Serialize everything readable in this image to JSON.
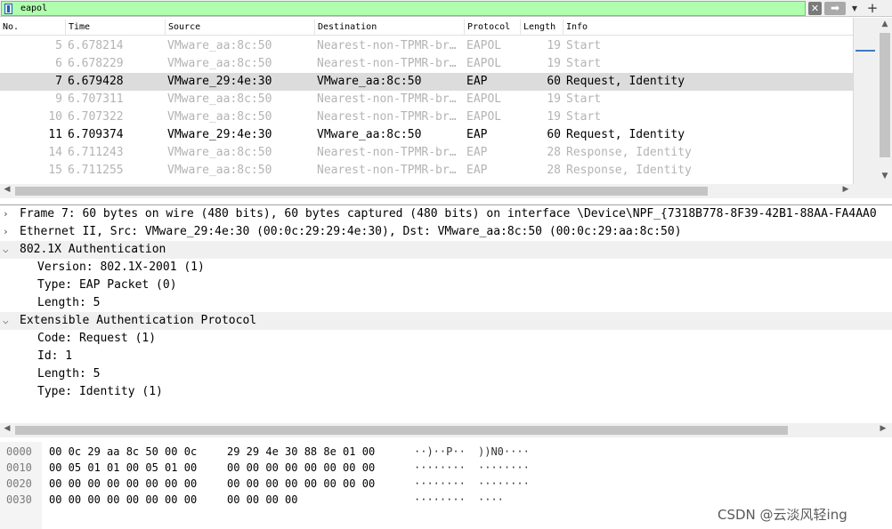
{
  "filter": {
    "value": "eapol"
  },
  "columns": {
    "no": "No.",
    "time": "Time",
    "source": "Source",
    "destination": "Destination",
    "protocol": "Protocol",
    "length": "Length",
    "info": "Info"
  },
  "packets": [
    {
      "no": "5",
      "time": "6.678214",
      "source": "VMware_aa:8c:50",
      "destination": "Nearest-non-TPMR-br…",
      "protocol": "EAPOL",
      "length": "19",
      "info": "Start",
      "style": "dim"
    },
    {
      "no": "6",
      "time": "6.678229",
      "source": "VMware_aa:8c:50",
      "destination": "Nearest-non-TPMR-br…",
      "protocol": "EAPOL",
      "length": "19",
      "info": "Start",
      "style": "dim"
    },
    {
      "no": "7",
      "time": "6.679428",
      "source": "VMware_29:4e:30",
      "destination": "VMware_aa:8c:50",
      "protocol": "EAP",
      "length": "60",
      "info": "Request, Identity",
      "style": "selected"
    },
    {
      "no": "9",
      "time": "6.707311",
      "source": "VMware_aa:8c:50",
      "destination": "Nearest-non-TPMR-br…",
      "protocol": "EAPOL",
      "length": "19",
      "info": "Start",
      "style": "dim"
    },
    {
      "no": "10",
      "time": "6.707322",
      "source": "VMware_aa:8c:50",
      "destination": "Nearest-non-TPMR-br…",
      "protocol": "EAPOL",
      "length": "19",
      "info": "Start",
      "style": "dim"
    },
    {
      "no": "11",
      "time": "6.709374",
      "source": "VMware_29:4e:30",
      "destination": "VMware_aa:8c:50",
      "protocol": "EAP",
      "length": "60",
      "info": "Request, Identity",
      "style": "eap"
    },
    {
      "no": "14",
      "time": "6.711243",
      "source": "VMware_aa:8c:50",
      "destination": "Nearest-non-TPMR-br…",
      "protocol": "EAP",
      "length": "28",
      "info": "Response, Identity",
      "style": "dim"
    },
    {
      "no": "15",
      "time": "6.711255",
      "source": "VMware_aa:8c:50",
      "destination": "Nearest-non-TPMR-br…",
      "protocol": "EAP",
      "length": "28",
      "info": "Response, Identity",
      "style": "dim"
    }
  ],
  "details": [
    {
      "text": "Frame 7: 60 bytes on wire (480 bits), 60 bytes captured (480 bits) on interface \\Device\\NPF_{7318B778-8F39-42B1-88AA-FA4AA0",
      "level": 0,
      "toggle": ">"
    },
    {
      "text": "Ethernet II, Src: VMware_29:4e:30 (00:0c:29:29:4e:30), Dst: VMware_aa:8c:50 (00:0c:29:aa:8c:50)",
      "level": 0,
      "toggle": ">"
    },
    {
      "text": "802.1X Authentication",
      "level": 0,
      "toggle": "v",
      "section": true
    },
    {
      "text": "Version: 802.1X-2001 (1)",
      "level": 1
    },
    {
      "text": "Type: EAP Packet (0)",
      "level": 1
    },
    {
      "text": "Length: 5",
      "level": 1
    },
    {
      "text": "Extensible Authentication Protocol",
      "level": 0,
      "toggle": "v",
      "section": true
    },
    {
      "text": "Code: Request (1)",
      "level": 1
    },
    {
      "text": "Id: 1",
      "level": 1
    },
    {
      "text": "Length: 5",
      "level": 1
    },
    {
      "text": "Type: Identity (1)",
      "level": 1
    }
  ],
  "hex": [
    {
      "offset": "0000",
      "bytes1": "00 0c 29 aa 8c 50 00 0c",
      "bytes2": "29 29 4e 30 88 8e 01 00",
      "ascii1": "··)··P··",
      "ascii2": "))N0····"
    },
    {
      "offset": "0010",
      "bytes1": "00 05 01 01 00 05 01 00",
      "bytes2": "00 00 00 00 00 00 00 00",
      "ascii1": "········",
      "ascii2": "········"
    },
    {
      "offset": "0020",
      "bytes1": "00 00 00 00 00 00 00 00",
      "bytes2": "00 00 00 00 00 00 00 00",
      "ascii1": "········",
      "ascii2": "········"
    },
    {
      "offset": "0030",
      "bytes1": "00 00 00 00 00 00 00 00",
      "bytes2": "00 00 00 00",
      "ascii1": "········",
      "ascii2": "····"
    }
  ],
  "watermark": "CSDN @云淡风轻ing"
}
